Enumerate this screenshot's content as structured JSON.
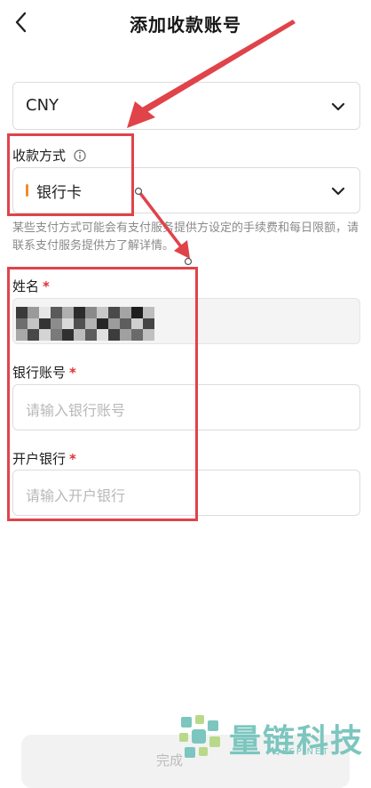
{
  "header": {
    "title": "添加收款账号"
  },
  "currency": {
    "value": "CNY"
  },
  "payment_method": {
    "label": "收款方式",
    "value": "银行卡",
    "accent_color": "#f08c28"
  },
  "note": "某些支付方式可能会有支付服务提供方设定的手续费和每日限额，请联系支付服务提供方了解详情。",
  "name_field": {
    "label": "姓名",
    "required_mark": "*"
  },
  "bank_account": {
    "label": "银行账号",
    "required_mark": "*",
    "placeholder": "请输入银行账号"
  },
  "bank_name": {
    "label": "开户银行",
    "required_mark": "*",
    "placeholder": "请输入开户银行"
  },
  "submit": {
    "label": "完成"
  },
  "watermark": {
    "text": "量链科技",
    "sub": "QFSP.NET"
  },
  "colors": {
    "annotation_red": "#e0434a",
    "required_red": "#e03232",
    "watermark": "#7cc6bf"
  }
}
